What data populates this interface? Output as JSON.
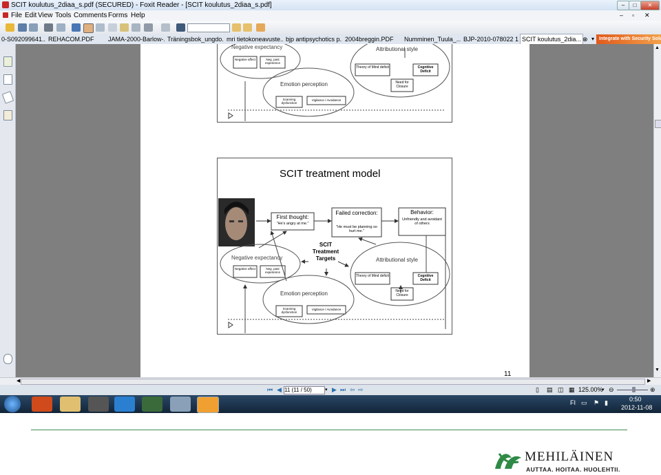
{
  "window": {
    "title": "SCIT koulutus_2diaa_s.pdf (SECURED) - Foxit Reader - [SCIT koulutus_2diaa_s.pdf]",
    "controls": [
      "–",
      "□",
      "✕"
    ]
  },
  "menu": [
    "File",
    "Edit",
    "View",
    "Tools",
    "Comments",
    "Forms",
    "Help"
  ],
  "tabs": [
    "0-S092099641...",
    "REHACOM.PDF",
    "JAMA-2000-Barlow-...",
    "Träningsbok_ungdo...",
    "mri tietokoneavuste...",
    "bjp antipsychotics p...",
    "2004breggin.PDF",
    "Numminen_Tuula_...",
    "BJP-2010-078022 1...",
    "SCIT koulutus_2dia..."
  ],
  "promo": "Integrate with Security Solution",
  "slide_top": {
    "negative_expectancy": "Negative expectancy",
    "neg_affect": "Negative affect",
    "neg_past": "Neg. past experience",
    "attributional_style": "Attributional style",
    "theory_of_mind": "Theory of Mind deficit",
    "cognitive_deficit": "Cognitive Deficit",
    "need_for_closure": "Need for Closure",
    "emotion_perception": "Emotion perception",
    "scanning": "Scanning dysfunction",
    "vigilance": "Vigilance / Avoidance"
  },
  "slide_main": {
    "title": "SCIT treatment model",
    "first_thought": "First thought:",
    "first_thought_quote": "\"He's angry at me.\"",
    "failed_correction": "Failed correction:",
    "failed_quote": "\"He must be planning so hurt me.\"",
    "behavior": "Behavior:",
    "behavior_desc": "Unfriendly and avoidant of others",
    "targets": "SCIT Treatment Targets",
    "negative_expectancy": "Negative expectancy",
    "neg_affect": "Negative affect",
    "neg_past": "Neg. past experience",
    "attributional_style": "Attributional style",
    "theory_of_mind": "Theory of Mind deficit",
    "cognitive_deficit": "Cognitive Deficit",
    "need_for_closure": "Need for Closure",
    "emotion_perception": "Emotion perception",
    "scanning": "Scanning dysfunction",
    "vigilance": "Vigilance / Avoidance"
  },
  "page_number": "11",
  "status": {
    "page": "11 (11 / 50)",
    "zoom": "125.00%"
  },
  "taskbar": {
    "lang": "FI",
    "time": "0:50",
    "date": "2012-11-08"
  },
  "brand": {
    "name": "MEHILÄINEN",
    "tagline": "AUTTAA. HOITAA. HUOLEHTII."
  }
}
